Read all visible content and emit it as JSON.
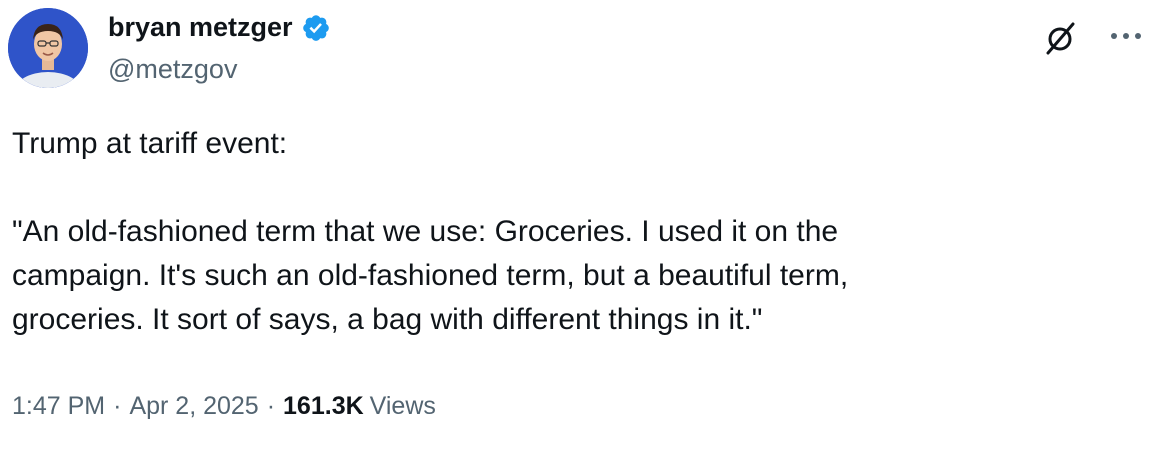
{
  "author": {
    "display_name": "bryan metzger",
    "handle": "@metzgov",
    "verified": true
  },
  "tweet": {
    "line1": "Trump at tariff event:",
    "quote_lines": [
      "\"An old-fashioned term that we use: Groceries. I used it on the",
      "campaign. It's such an old-fashioned term, but a beautiful term,",
      "groceries. It sort of says, a bag with different things in it.\""
    ]
  },
  "meta": {
    "time": "1:47 PM",
    "date": "Apr 2, 2025",
    "separator": "·",
    "views_count": "161.3K",
    "views_label": "Views"
  },
  "icons": {
    "verified": "verified-badge-icon",
    "grok": "grok-icon",
    "more": "more-options-icon"
  },
  "colors": {
    "text": "#0f1419",
    "secondary": "#536471",
    "verified_blue": "#1d9bf0",
    "avatar_bg": "#2f54c9"
  }
}
